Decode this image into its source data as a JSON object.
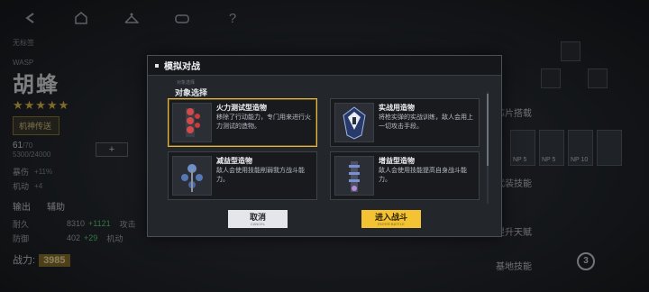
{
  "left_panel": {
    "label_unnamed": "无标签",
    "code": "WASP",
    "name": "胡蜂",
    "stars": "★★★★★",
    "mecha_transfer": "机神传送",
    "level": "61",
    "level_max": "/70",
    "exp": "5300/24000",
    "plus": "+",
    "stat_rows": [
      {
        "label": "暴伤",
        "value": "+11%"
      },
      {
        "label": "机动",
        "value": "+4"
      }
    ],
    "tabs": [
      "输出",
      "辅助"
    ],
    "attrs": [
      {
        "label": "耐久",
        "value": "8310",
        "bonus": "+1121"
      },
      {
        "label": "攻击",
        "value": "",
        "bonus": ""
      },
      {
        "label": "防御",
        "value": "402",
        "bonus": "+29"
      },
      {
        "label": "机动",
        "value": "113",
        "bonus": "+21"
      }
    ],
    "power_label": "战力:",
    "power_value": "3985"
  },
  "right_panel": {
    "parts_label": "芯片搭载",
    "weapon_label": "武装技能",
    "ascend_label": "提升天赋",
    "base_skill_label": "基地技能",
    "np_values": [
      "NP 5",
      "NP 5",
      "NP 10"
    ],
    "badge": "3"
  },
  "dialog": {
    "title": "模拟对战",
    "subtitle_tiny": "对象选择",
    "subtitle": "对象选择",
    "cards": [
      {
        "name": "火力测试型造物",
        "desc": "移除了行动能力，专门用来进行火力测试的造物。",
        "selected": true
      },
      {
        "name": "实战用造物",
        "desc": "将枪实弹的实战训练，敌人会用上一切攻击手段。",
        "selected": false
      },
      {
        "name": "减益型造物",
        "desc": "敌人会使用技能削弱我方战斗能力。",
        "selected": false
      },
      {
        "name": "增益型造物",
        "desc": "敌人会使用技能提高自身战斗能力。",
        "selected": false
      }
    ],
    "cancel_label": "取消",
    "cancel_sub": "CANCEL",
    "enter_label": "进入战斗",
    "enter_sub": "ENTER BATTLE"
  },
  "colors": {
    "accent_gold": "#f4c334",
    "selected_border": "#e2b640",
    "stat_green": "#63d27a"
  },
  "icons": [
    "back-icon",
    "home-icon",
    "wardrobe-icon",
    "gamepad-icon",
    "help-icon"
  ]
}
